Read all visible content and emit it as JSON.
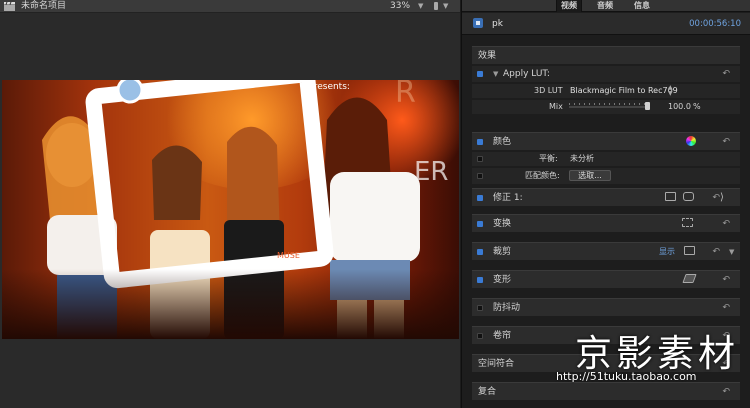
{
  "viewer": {
    "project_title": "未命名项目",
    "zoom": "33%",
    "frame_text": {
      "presents": "presents:",
      "muse": "MUSE"
    }
  },
  "inspector": {
    "tabs": [
      {
        "label": "视频",
        "active": true
      },
      {
        "label": "音频",
        "active": false
      },
      {
        "label": "信息",
        "active": false
      }
    ],
    "clip": {
      "name": "pk",
      "duration": "00:00:56:10"
    },
    "effects_header": "效果",
    "apply_lut": {
      "title": "Apply LUT:",
      "lut_label": "3D LUT",
      "lut_value": "Blackmagic Film to Rec709",
      "mix_label": "Mix",
      "mix_value": "100.0",
      "mix_unit": "%",
      "mix_level": 1.0
    },
    "color": {
      "title": "颜色",
      "balance_label": "平衡:",
      "balance_value": "未分析",
      "match_label": "匹配颜色:",
      "match_button": "选取..."
    },
    "correction": {
      "title": "修正 1:"
    },
    "transform": {
      "title": "变换"
    },
    "crop": {
      "title": "裁剪",
      "show": "显示"
    },
    "distort": {
      "title": "变形"
    },
    "stabilization": {
      "title": "防抖动"
    },
    "rolling_shutter": {
      "title": "卷帘"
    },
    "spatial_conform": {
      "title": "空间符合"
    },
    "compositing": {
      "title": "复合"
    }
  },
  "watermark": {
    "brand": "京影素材",
    "url": "http://51tuku.taobao.com"
  },
  "colors": {
    "accent": "#3a7bd5",
    "timecode": "#6fa3e0"
  }
}
